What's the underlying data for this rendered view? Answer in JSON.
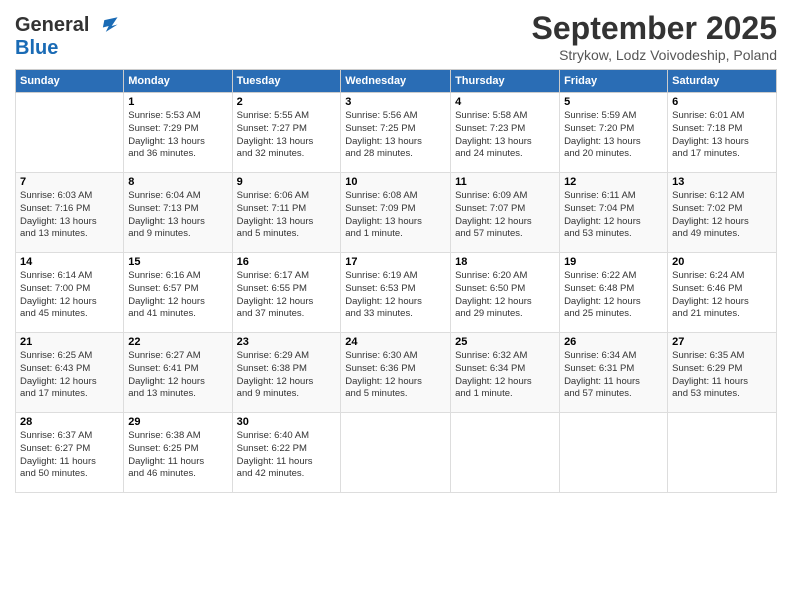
{
  "header": {
    "logo_line1": "General",
    "logo_line2": "Blue",
    "month_title": "September 2025",
    "subtitle": "Strykow, Lodz Voivodeship, Poland"
  },
  "days_of_week": [
    "Sunday",
    "Monday",
    "Tuesday",
    "Wednesday",
    "Thursday",
    "Friday",
    "Saturday"
  ],
  "weeks": [
    [
      {
        "num": "",
        "info": ""
      },
      {
        "num": "1",
        "info": "Sunrise: 5:53 AM\nSunset: 7:29 PM\nDaylight: 13 hours\nand 36 minutes."
      },
      {
        "num": "2",
        "info": "Sunrise: 5:55 AM\nSunset: 7:27 PM\nDaylight: 13 hours\nand 32 minutes."
      },
      {
        "num": "3",
        "info": "Sunrise: 5:56 AM\nSunset: 7:25 PM\nDaylight: 13 hours\nand 28 minutes."
      },
      {
        "num": "4",
        "info": "Sunrise: 5:58 AM\nSunset: 7:23 PM\nDaylight: 13 hours\nand 24 minutes."
      },
      {
        "num": "5",
        "info": "Sunrise: 5:59 AM\nSunset: 7:20 PM\nDaylight: 13 hours\nand 20 minutes."
      },
      {
        "num": "6",
        "info": "Sunrise: 6:01 AM\nSunset: 7:18 PM\nDaylight: 13 hours\nand 17 minutes."
      }
    ],
    [
      {
        "num": "7",
        "info": "Sunrise: 6:03 AM\nSunset: 7:16 PM\nDaylight: 13 hours\nand 13 minutes."
      },
      {
        "num": "8",
        "info": "Sunrise: 6:04 AM\nSunset: 7:13 PM\nDaylight: 13 hours\nand 9 minutes."
      },
      {
        "num": "9",
        "info": "Sunrise: 6:06 AM\nSunset: 7:11 PM\nDaylight: 13 hours\nand 5 minutes."
      },
      {
        "num": "10",
        "info": "Sunrise: 6:08 AM\nSunset: 7:09 PM\nDaylight: 13 hours\nand 1 minute."
      },
      {
        "num": "11",
        "info": "Sunrise: 6:09 AM\nSunset: 7:07 PM\nDaylight: 12 hours\nand 57 minutes."
      },
      {
        "num": "12",
        "info": "Sunrise: 6:11 AM\nSunset: 7:04 PM\nDaylight: 12 hours\nand 53 minutes."
      },
      {
        "num": "13",
        "info": "Sunrise: 6:12 AM\nSunset: 7:02 PM\nDaylight: 12 hours\nand 49 minutes."
      }
    ],
    [
      {
        "num": "14",
        "info": "Sunrise: 6:14 AM\nSunset: 7:00 PM\nDaylight: 12 hours\nand 45 minutes."
      },
      {
        "num": "15",
        "info": "Sunrise: 6:16 AM\nSunset: 6:57 PM\nDaylight: 12 hours\nand 41 minutes."
      },
      {
        "num": "16",
        "info": "Sunrise: 6:17 AM\nSunset: 6:55 PM\nDaylight: 12 hours\nand 37 minutes."
      },
      {
        "num": "17",
        "info": "Sunrise: 6:19 AM\nSunset: 6:53 PM\nDaylight: 12 hours\nand 33 minutes."
      },
      {
        "num": "18",
        "info": "Sunrise: 6:20 AM\nSunset: 6:50 PM\nDaylight: 12 hours\nand 29 minutes."
      },
      {
        "num": "19",
        "info": "Sunrise: 6:22 AM\nSunset: 6:48 PM\nDaylight: 12 hours\nand 25 minutes."
      },
      {
        "num": "20",
        "info": "Sunrise: 6:24 AM\nSunset: 6:46 PM\nDaylight: 12 hours\nand 21 minutes."
      }
    ],
    [
      {
        "num": "21",
        "info": "Sunrise: 6:25 AM\nSunset: 6:43 PM\nDaylight: 12 hours\nand 17 minutes."
      },
      {
        "num": "22",
        "info": "Sunrise: 6:27 AM\nSunset: 6:41 PM\nDaylight: 12 hours\nand 13 minutes."
      },
      {
        "num": "23",
        "info": "Sunrise: 6:29 AM\nSunset: 6:38 PM\nDaylight: 12 hours\nand 9 minutes."
      },
      {
        "num": "24",
        "info": "Sunrise: 6:30 AM\nSunset: 6:36 PM\nDaylight: 12 hours\nand 5 minutes."
      },
      {
        "num": "25",
        "info": "Sunrise: 6:32 AM\nSunset: 6:34 PM\nDaylight: 12 hours\nand 1 minute."
      },
      {
        "num": "26",
        "info": "Sunrise: 6:34 AM\nSunset: 6:31 PM\nDaylight: 11 hours\nand 57 minutes."
      },
      {
        "num": "27",
        "info": "Sunrise: 6:35 AM\nSunset: 6:29 PM\nDaylight: 11 hours\nand 53 minutes."
      }
    ],
    [
      {
        "num": "28",
        "info": "Sunrise: 6:37 AM\nSunset: 6:27 PM\nDaylight: 11 hours\nand 50 minutes."
      },
      {
        "num": "29",
        "info": "Sunrise: 6:38 AM\nSunset: 6:25 PM\nDaylight: 11 hours\nand 46 minutes."
      },
      {
        "num": "30",
        "info": "Sunrise: 6:40 AM\nSunset: 6:22 PM\nDaylight: 11 hours\nand 42 minutes."
      },
      {
        "num": "",
        "info": ""
      },
      {
        "num": "",
        "info": ""
      },
      {
        "num": "",
        "info": ""
      },
      {
        "num": "",
        "info": ""
      }
    ]
  ]
}
